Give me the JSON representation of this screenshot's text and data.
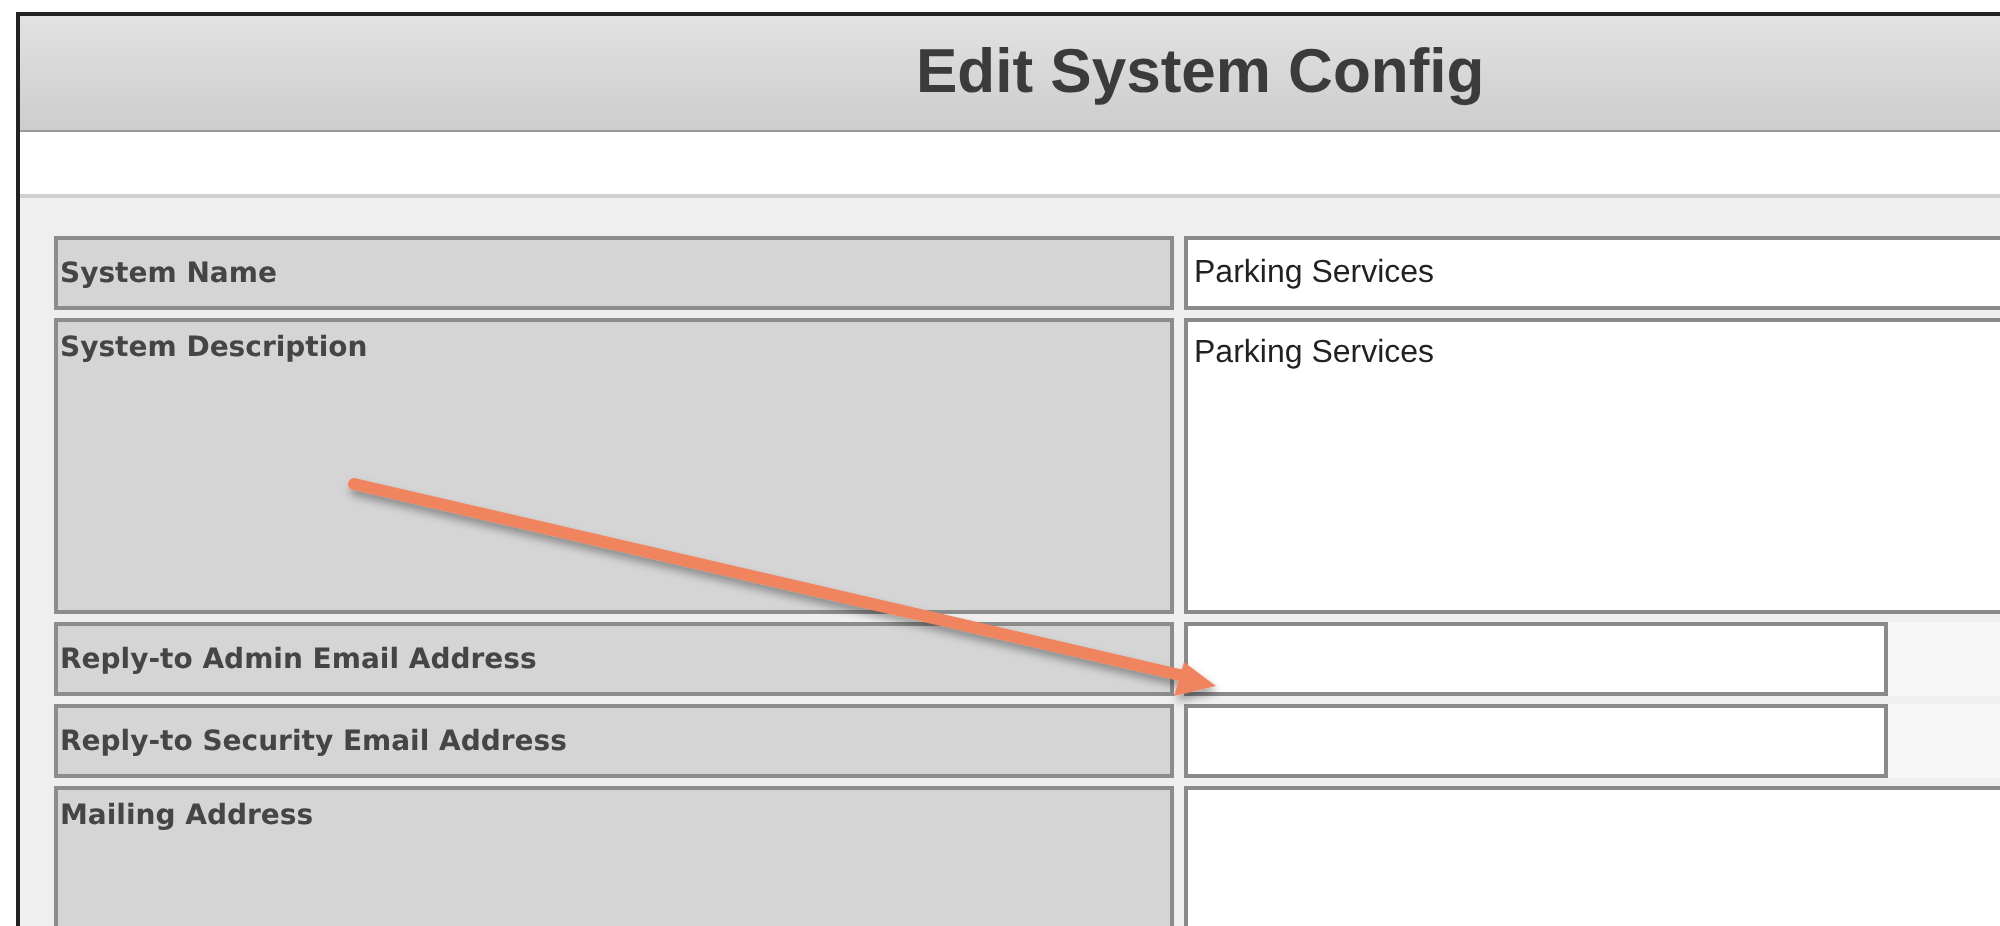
{
  "title": "Edit System Config",
  "fields": [
    {
      "label": "System Name",
      "kind": "input",
      "value": "Parking Services"
    },
    {
      "label": "System Description",
      "kind": "textarea",
      "value": "Parking Services"
    },
    {
      "label": "Reply-to Admin Email Address",
      "kind": "short-input"
    },
    {
      "label": "Reply-to Security Email Address",
      "kind": "short-input"
    },
    {
      "label": "Mailing Address",
      "kind": "textarea"
    }
  ]
}
